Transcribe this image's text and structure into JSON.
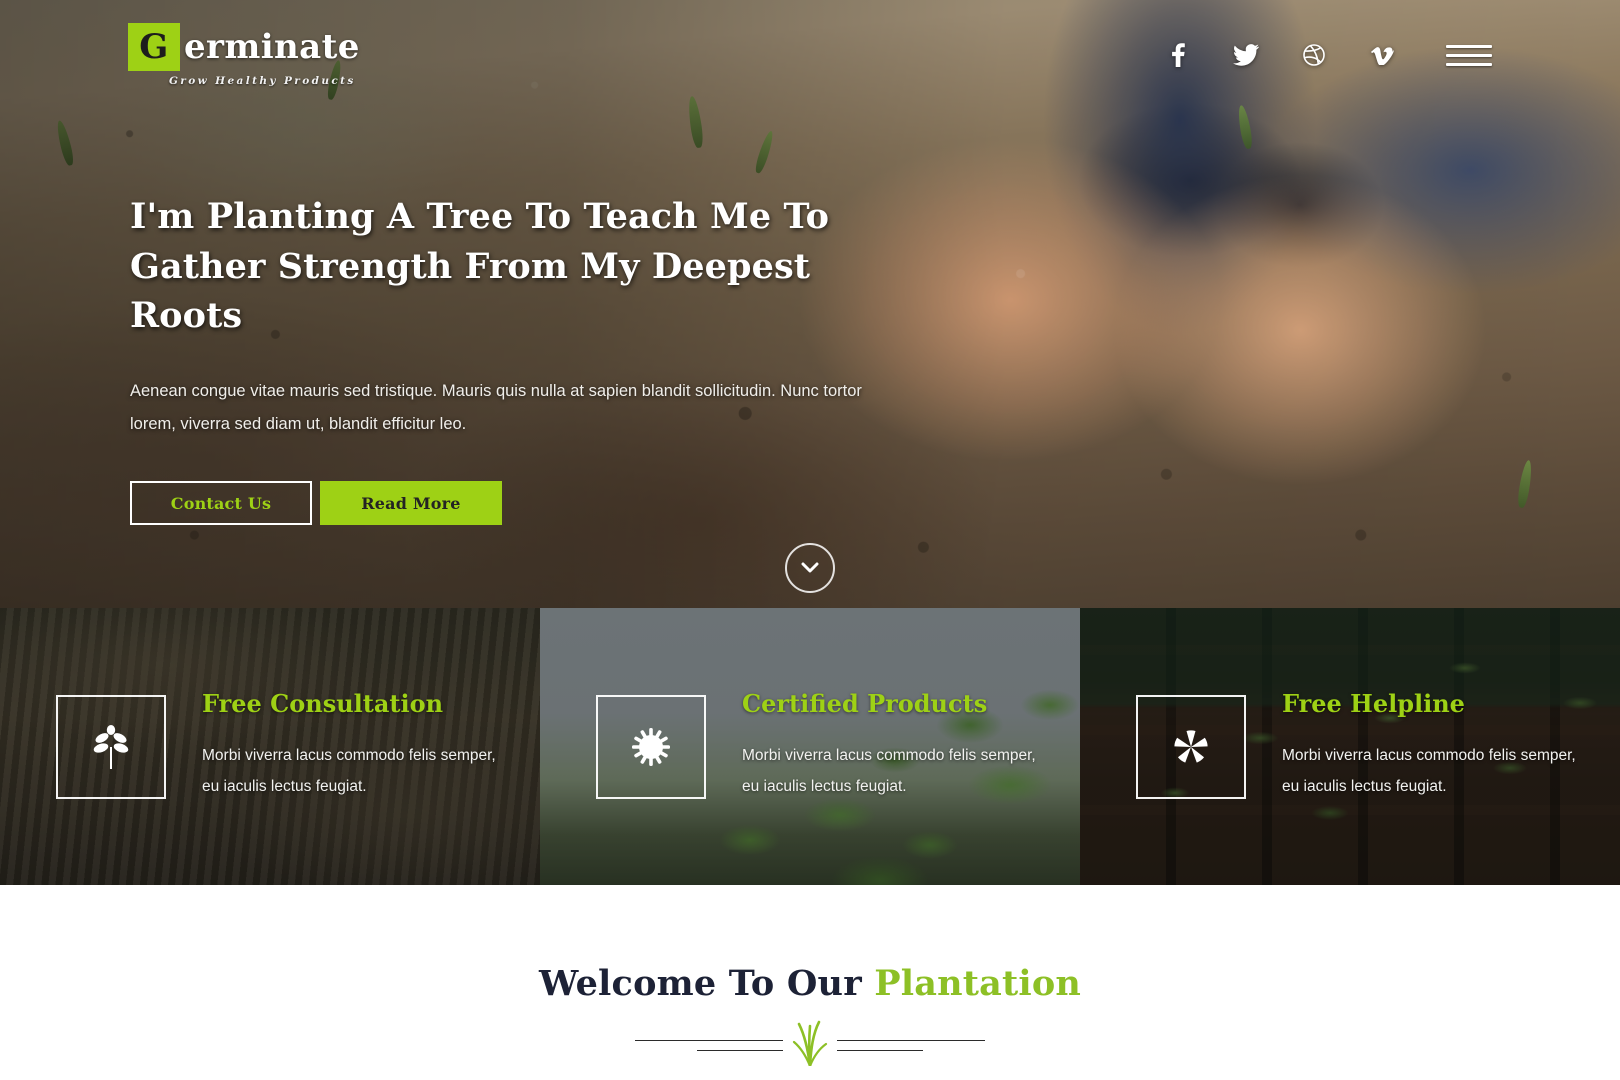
{
  "theme": {
    "accent_green": "#9ed115",
    "title_green": "#8dc026",
    "dark_navy": "#1d2236"
  },
  "header": {
    "logo": {
      "badge_letter": "G",
      "rest": "erminate",
      "tagline": "Grow Healthy Products"
    },
    "social": [
      {
        "name": "facebook-icon",
        "label": "Facebook"
      },
      {
        "name": "twitter-icon",
        "label": "Twitter"
      },
      {
        "name": "dribbble-icon",
        "label": "Dribbble"
      },
      {
        "name": "vimeo-icon",
        "label": "Vimeo"
      }
    ],
    "menu_label": "Menu"
  },
  "hero": {
    "title": "I'm Planting A Tree To Teach Me To Gather Strength From My Deepest Roots",
    "subtitle": "Aenean congue vitae mauris sed tristique. Mauris quis nulla at sapien blandit sollicitudin. Nunc tortor lorem, viverra sed diam ut, blandit efficitur leo.",
    "buttons": {
      "contact": "Contact Us",
      "read_more": "Read More"
    },
    "scroll_down_label": "Scroll down"
  },
  "features": [
    {
      "icon": "leaf-icon",
      "title": "Free Consultation",
      "desc": "Morbi viverra lacus commodo felis semper, eu iaculis lectus feugiat."
    },
    {
      "icon": "sun-burst-icon",
      "title": "Certified Products",
      "desc": "Morbi viverra lacus commodo felis semper, eu iaculis lectus feugiat."
    },
    {
      "icon": "flower-icon",
      "title": "Free Helpline",
      "desc": "Morbi viverra lacus commodo felis semper, eu iaculis lectus feugiat."
    }
  ],
  "welcome": {
    "title_plain": "Welcome To Our ",
    "title_accent": "Plantation"
  }
}
